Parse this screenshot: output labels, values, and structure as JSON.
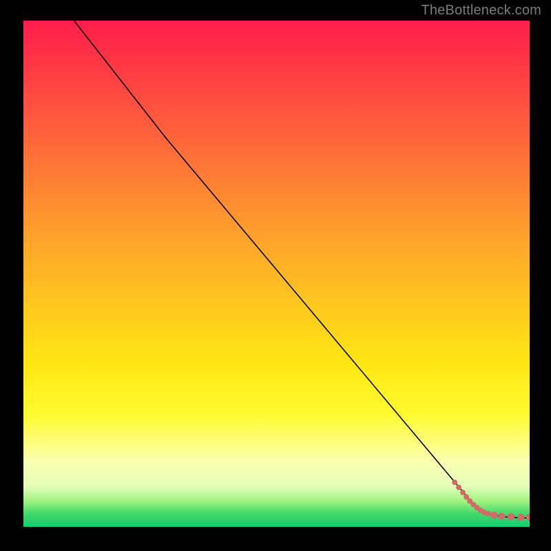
{
  "attribution": "TheBottleneck.com",
  "chart_data": {
    "type": "line",
    "title": "",
    "xlabel": "",
    "ylabel": "",
    "xlim": [
      0,
      100
    ],
    "ylim": [
      0,
      100
    ],
    "series": [
      {
        "name": "curve",
        "x": [
          10,
          28,
          85.5,
          88,
          90,
          92,
          95,
          98,
          100
        ],
        "y": [
          100,
          77,
          8.5,
          5.5,
          3.5,
          2.5,
          2.0,
          1.8,
          1.8
        ],
        "stroke": "#000000",
        "stroke_width": 1.6
      }
    ],
    "markers": [
      {
        "name": "dots",
        "fill": "#d26a6a",
        "r_small": 4.0,
        "r_large": 5.2,
        "points": [
          {
            "x": 85.2,
            "y": 8.8,
            "r": "small"
          },
          {
            "x": 86.0,
            "y": 7.8,
            "r": "small"
          },
          {
            "x": 86.8,
            "y": 6.8,
            "r": "small"
          },
          {
            "x": 87.5,
            "y": 5.9,
            "r": "small"
          },
          {
            "x": 88.2,
            "y": 5.1,
            "r": "small"
          },
          {
            "x": 88.9,
            "y": 4.4,
            "r": "small"
          },
          {
            "x": 89.6,
            "y": 3.8,
            "r": "small"
          },
          {
            "x": 90.3,
            "y": 3.3,
            "r": "small"
          },
          {
            "x": 91.0,
            "y": 2.9,
            "r": "small"
          },
          {
            "x": 91.8,
            "y": 2.6,
            "r": "small"
          },
          {
            "x": 93.0,
            "y": 2.3,
            "r": "large"
          },
          {
            "x": 94.5,
            "y": 2.1,
            "r": "large"
          },
          {
            "x": 96.3,
            "y": 2.0,
            "r": "large"
          },
          {
            "x": 98.3,
            "y": 1.9,
            "r": "large"
          },
          {
            "x": 100.0,
            "y": 1.9,
            "r": "large"
          }
        ]
      }
    ],
    "gradient_stops": [
      {
        "pct": 0,
        "color": "#ff1d4b"
      },
      {
        "pct": 10,
        "color": "#ff3b43"
      },
      {
        "pct": 25,
        "color": "#ff6b3a"
      },
      {
        "pct": 40,
        "color": "#ff9a2e"
      },
      {
        "pct": 55,
        "color": "#ffc420"
      },
      {
        "pct": 68,
        "color": "#ffe713"
      },
      {
        "pct": 78,
        "color": "#fffb32"
      },
      {
        "pct": 87,
        "color": "#fcffb0"
      },
      {
        "pct": 92,
        "color": "#e4ffb8"
      },
      {
        "pct": 95,
        "color": "#9cf27e"
      },
      {
        "pct": 97.5,
        "color": "#3fd869"
      },
      {
        "pct": 100,
        "color": "#1acb72"
      }
    ]
  }
}
